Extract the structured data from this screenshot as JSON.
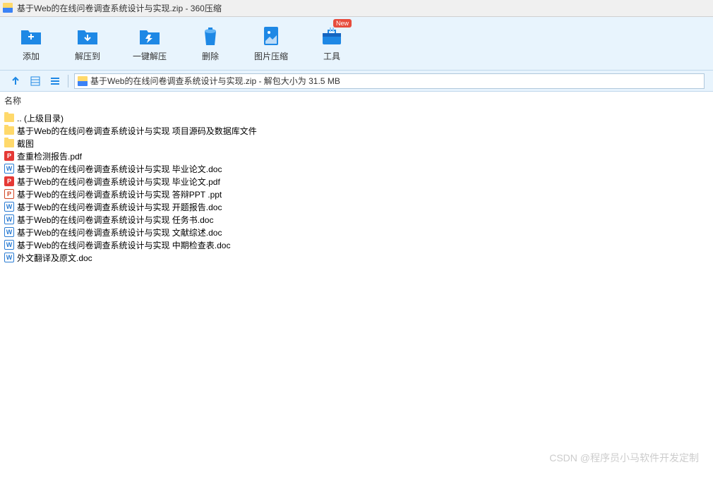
{
  "titlebar": {
    "text": "基于Web的在线问卷调查系统设计与实现.zip - 360压缩"
  },
  "toolbar": {
    "add": "添加",
    "extract": "解压到",
    "oneclick": "一键解压",
    "delete": "删除",
    "imagecompress": "图片压缩",
    "tools": "工具",
    "new_badge": "New"
  },
  "pathbar": {
    "text": "基于Web的在线问卷调查系统设计与实现.zip - 解包大小为 31.5 MB"
  },
  "columns": {
    "name": "名称"
  },
  "files": [
    {
      "type": "folder",
      "name": ".. (上级目录)"
    },
    {
      "type": "folder",
      "name": "基于Web的在线问卷调查系统设计与实现 项目源码及数据库文件"
    },
    {
      "type": "folder",
      "name": "截图"
    },
    {
      "type": "pdf",
      "name": "查重检测报告.pdf"
    },
    {
      "type": "word",
      "name": "基于Web的在线问卷调查系统设计与实现 毕业论文.doc"
    },
    {
      "type": "pdf",
      "name": "基于Web的在线问卷调查系统设计与实现 毕业论文.pdf"
    },
    {
      "type": "ppt",
      "name": "基于Web的在线问卷调查系统设计与实现 答辩PPT .ppt"
    },
    {
      "type": "word",
      "name": "基于Web的在线问卷调查系统设计与实现 开题报告.doc"
    },
    {
      "type": "word",
      "name": "基于Web的在线问卷调查系统设计与实现 任务书.doc"
    },
    {
      "type": "word",
      "name": "基于Web的在线问卷调查系统设计与实现 文献综述.doc"
    },
    {
      "type": "word",
      "name": "基于Web的在线问卷调查系统设计与实现 中期检查表.doc"
    },
    {
      "type": "word",
      "name": "外文翻译及原文.doc"
    }
  ],
  "watermark": "CSDN @程序员小马软件开发定制"
}
